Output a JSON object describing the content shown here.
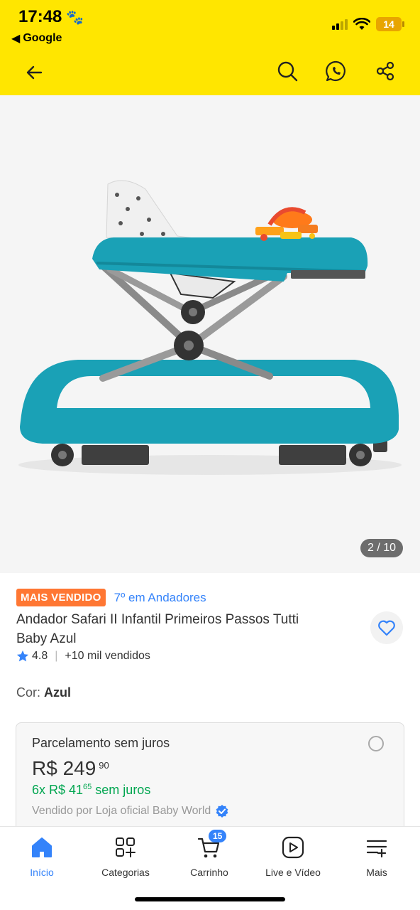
{
  "status_bar": {
    "time": "17:48",
    "back_app": "Google",
    "battery": "14"
  },
  "header": {
    "icons": [
      "back-arrow-icon",
      "search-icon",
      "whatsapp-icon",
      "share-icon"
    ]
  },
  "gallery": {
    "counter": "2 / 10"
  },
  "product": {
    "badge": "MAIS VENDIDO",
    "rank": "7º em Andadores",
    "title": "Andador Safari II Infantil Primeiros Passos Tutti Baby Azul",
    "rating": "4.8",
    "sold": "+10 mil vendidos",
    "color_label": "Cor:",
    "color_value": "Azul"
  },
  "payment": {
    "title": "Parcelamento sem juros",
    "price_main": "R$ 249",
    "price_cents": "90",
    "installments_prefix": "6x R$ 41",
    "installments_cents": "65",
    "installments_suffix": " sem juros",
    "seller": "Vendido por Loja oficial Baby World"
  },
  "bottom_nav": {
    "items": [
      {
        "label": "Início",
        "icon": "home-icon",
        "active": true
      },
      {
        "label": "Categorias",
        "icon": "categories-icon",
        "active": false
      },
      {
        "label": "Carrinho",
        "icon": "cart-icon",
        "active": false
      },
      {
        "label": "Live e Vídeo",
        "icon": "play-icon",
        "active": false
      },
      {
        "label": "Mais",
        "icon": "more-icon",
        "active": false
      }
    ],
    "cart_count": "15"
  },
  "colors": {
    "header_bg": "#FFE600",
    "accent_blue": "#3483FA",
    "badge_orange": "#FF7733",
    "green": "#00A650"
  }
}
